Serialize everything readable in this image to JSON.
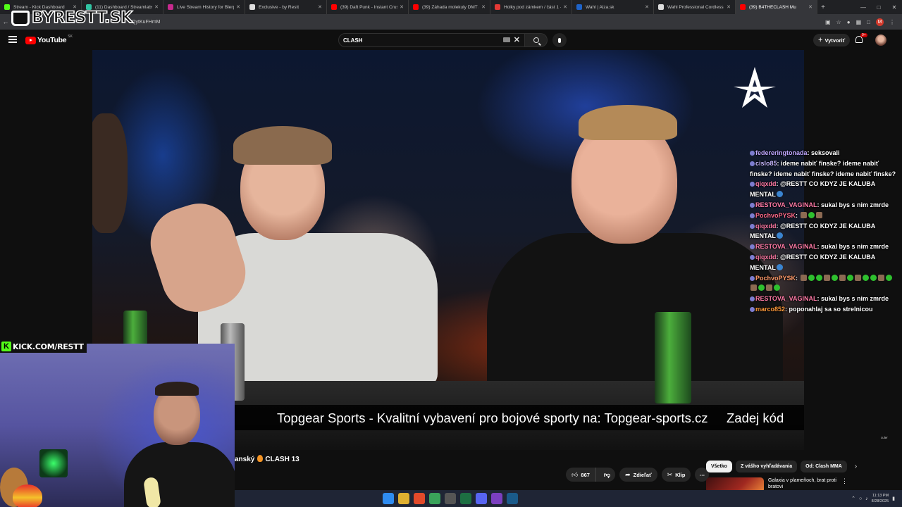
{
  "browser": {
    "tabs": [
      {
        "label": "Stream - Kick Dashboard",
        "color": "#53fc18"
      },
      {
        "label": "(11) Dashboard / Streamlabs",
        "color": "#31c3a2"
      },
      {
        "label": "Live Stream History for Blerp",
        "color": "#c72a8d"
      },
      {
        "label": "Exclusive - by Restt",
        "color": "#dddddd"
      },
      {
        "label": "(39) Daft Punk - Instant Crush",
        "color": "#ff0000"
      },
      {
        "label": "(39) Záhada molekuly DMT a",
        "color": "#ff0000"
      },
      {
        "label": "Holky pod zámkem / část 1 -",
        "color": "#e53935"
      },
      {
        "label": "Wahl | Alza.sk",
        "color": "#1e63c8"
      },
      {
        "label": "Wahl Professional Cordless",
        "color": "#dddddd"
      },
      {
        "label": "(39) B4THECLASH Mu",
        "color": "#ff0000"
      }
    ],
    "url": "CQytKuFHmM"
  },
  "overlay": {
    "logo_text": "BYRESTT.SK",
    "kick_text": "KICK.COM/RESTT",
    "kick_letter": "K"
  },
  "youtube": {
    "wordmark": "YouTube",
    "country": "SK",
    "search_value": "CLASH",
    "create_label": "Vytvoriť",
    "notifications": "9+"
  },
  "video": {
    "ticker_text": "Topgear Sports - Kvalitní vybavení pro bojové sporty na: Topgear-sports.cz",
    "ticker_tail": "Zadej kód",
    "corner_credit": "culer",
    "title_prefix": "anský",
    "title_suffix": "CLASH 13"
  },
  "chat": [
    {
      "user": "federeringtonada",
      "color": "#bfa7ff",
      "text": "seksovali",
      "emotes": []
    },
    {
      "user": "cislo85",
      "color": "#c7b8ff",
      "text": "ideme nabiť finske? ideme nabiť finske? ideme nabiť finske? ideme nabiť finske?",
      "emotes": []
    },
    {
      "user": "qiqxdd",
      "color": "#ff7aa6",
      "text": "@RESTT CO KDYZ JE KALUBA MENTAL",
      "emotes": [
        "w"
      ]
    },
    {
      "user": "RESTOVA_VAGINAL",
      "color": "#ff7aa6",
      "text": "sukal bys s nim zmrde",
      "emotes": []
    },
    {
      "user": "PochvoPYSK",
      "color": "#ff6a8a",
      "text": "",
      "emotes": [
        "b",
        "g",
        "b"
      ]
    },
    {
      "user": "qiqxdd",
      "color": "#ff7aa6",
      "text": "@RESTT CO KDYZ JE KALUBA MENTAL",
      "emotes": [
        "w"
      ]
    },
    {
      "user": "RESTOVA_VAGINAL",
      "color": "#ff7aa6",
      "text": "sukal bys s nim zmrde",
      "emotes": []
    },
    {
      "user": "qiqxdd",
      "color": "#ff7aa6",
      "text": "@RESTT CO KDYZ JE KALUBA MENTAL",
      "emotes": [
        "w"
      ]
    },
    {
      "user": "PochvoPYSK",
      "color": "#ff9a6a",
      "text": "",
      "emotes": [
        "b",
        "g",
        "g",
        "b",
        "g",
        "b",
        "g",
        "b",
        "g",
        "g",
        "b",
        "g",
        "b",
        "g",
        "b",
        "g"
      ]
    },
    {
      "user": "RESTOVA_VAGINAL",
      "color": "#ff7aa6",
      "text": "sukal bys s nim zmrde",
      "emotes": []
    },
    {
      "user": "marco852",
      "color": "#ff9a3a",
      "text": "poponahlaj sa so strelnicou",
      "emotes": []
    }
  ],
  "actions": {
    "likes": "867",
    "share": "Zdieľať",
    "clip": "Klip"
  },
  "chips": [
    "Všetko",
    "Z vášho vyhľadávania",
    "Od: Clash MMA"
  ],
  "recommendation": {
    "title": "Galaxia v plameňoch, brat proti bratovi"
  },
  "taskbar": {
    "time": "11:13 PM",
    "date": "8/28/2025"
  }
}
